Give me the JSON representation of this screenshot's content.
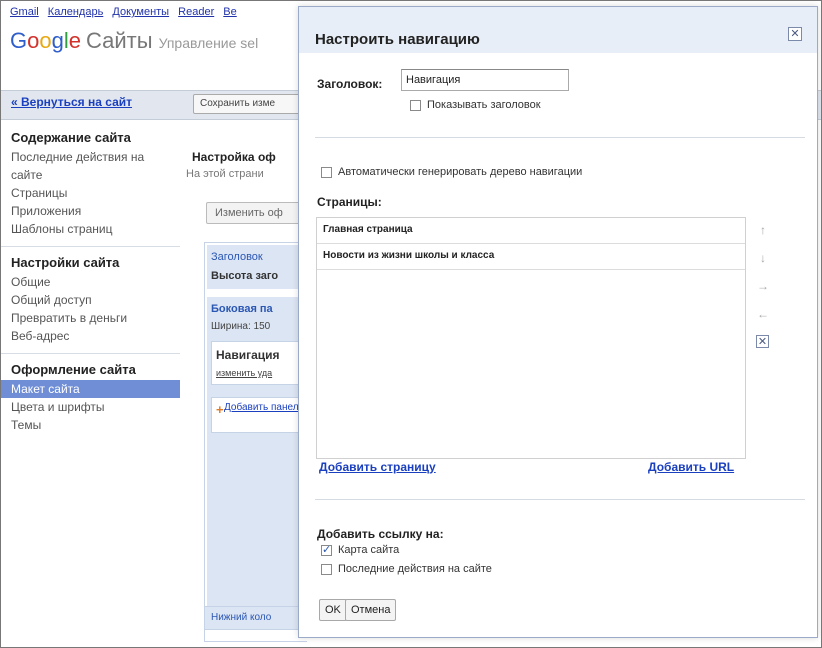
{
  "topnav": {
    "links": [
      "Gmail",
      "Календарь",
      "Документы",
      "Reader",
      "Ве"
    ]
  },
  "logo": {
    "google": "Google",
    "product": "Сайты",
    "subtitle": "Управление sel"
  },
  "backlink": "« Вернуться на сайт",
  "save_button": "Сохранить изме",
  "sidebar": {
    "sections": [
      {
        "heading": "Содержание сайта",
        "items": [
          "Последние действия на сайте",
          "Страницы",
          "Приложения",
          "Шаблоны страниц"
        ]
      },
      {
        "heading": "Настройки сайта",
        "items": [
          "Общие",
          "Общий доступ",
          "Превратить в деньги",
          "Веб-адрес"
        ]
      },
      {
        "heading": "Оформление сайта",
        "items": [
          "Макет сайта",
          "Цвета и шрифты",
          "Темы"
        ],
        "active_index": 0
      }
    ]
  },
  "content": {
    "title": "Настройка оф",
    "subtitle": "На этой страни",
    "change_button": "Изменить оф",
    "layout": {
      "header_label": "Заголовок",
      "header_height": "Высота заго",
      "sidebar_label": "Боковая па",
      "sidebar_width": "Ширина: 150",
      "nav_label": "Навигация",
      "nav_links": "изменить уда",
      "add_panel": "Добавить панель",
      "footer": "Нижний коло"
    }
  },
  "dialog": {
    "title": "Настроить навигацию",
    "close_icon": "close-x",
    "heading_label": "Заголовок:",
    "heading_value": "Навигация",
    "show_heading_label": "Показывать заголовок",
    "show_heading_checked": false,
    "auto_generate_label": "Автоматически генерировать дерево навигации",
    "auto_generate_checked": false,
    "pages_label": "Страницы:",
    "pages": [
      "Главная страница",
      "Новости из жизни школы и класса"
    ],
    "arrows": {
      "up": "↑",
      "down": "↓",
      "right": "→",
      "left": "←",
      "remove": "✕"
    },
    "add_page_link": "Добавить страницу",
    "add_url_link": "Добавить URL",
    "add_link_label": "Добавить ссылку на:",
    "link_options": [
      {
        "label": "Карта сайта",
        "checked": true
      },
      {
        "label": "Последние действия на сайте",
        "checked": false
      }
    ],
    "ok_button": "OK",
    "cancel_button": "Отмена"
  }
}
